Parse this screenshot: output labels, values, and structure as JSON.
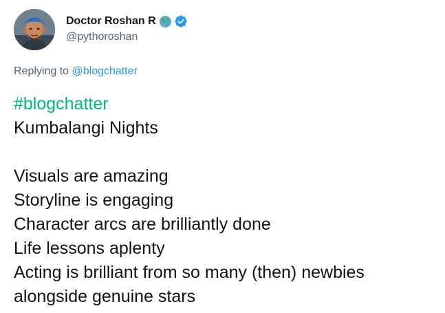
{
  "author": {
    "display_name": "Doctor Roshan R",
    "handle": "@pythoroshan",
    "verified": true
  },
  "reply": {
    "prefix": "Replying to ",
    "mention": "@blogchatter"
  },
  "tweet": {
    "hashtag": "#blogchatter",
    "lines": [
      "Kumbalangi Nights",
      "",
      "Visuals are amazing",
      "Storyline is engaging",
      "Character arcs are brilliantly done",
      "Life lessons aplenty",
      "Acting is brilliant from so many (then) newbies",
      "alongside genuine stars"
    ]
  },
  "icons": {
    "avatar": "profile-photo",
    "globe": "globe-icon",
    "verified": "verified-badge-icon"
  },
  "colors": {
    "text": "#0f1419",
    "secondary": "#536471",
    "mention": "#1d9bf0",
    "hashtag": "#00ba7c",
    "verified": "#1d9bf0"
  }
}
